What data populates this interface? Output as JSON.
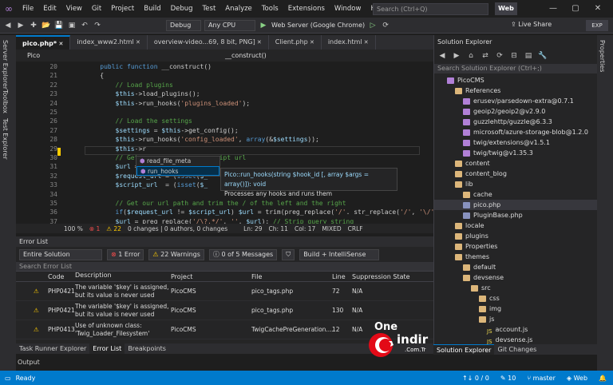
{
  "menubar": {
    "items": [
      "File",
      "Edit",
      "View",
      "Git",
      "Project",
      "Build",
      "Debug",
      "Test",
      "Analyze",
      "Tools",
      "Extensions",
      "Window",
      "Help"
    ],
    "search_placeholder": "Search (Ctrl+Q)",
    "badge": "Web"
  },
  "toolbar": {
    "config": "Debug",
    "platform": "Any CPU",
    "run_target": "Web Server (Google Chrome)",
    "liveshare": "Live Share",
    "exp": "EXP"
  },
  "left_rail": [
    "Server Explorer",
    "Toolbox",
    "Test Explorer"
  ],
  "right_rail": [
    "Properties"
  ],
  "tabs": [
    {
      "label": "pico.php*",
      "active": true
    },
    {
      "label": "index_www2.html",
      "active": false
    },
    {
      "label": "overview-video...69, 8 bit, PNG]",
      "active": false
    },
    {
      "label": "Client.php",
      "active": false
    },
    {
      "label": "index.html",
      "active": false
    }
  ],
  "navbar": {
    "left": "Pico",
    "right": "__construct()"
  },
  "code_lines": [
    {
      "n": "20",
      "t": "    public function __construct()"
    },
    {
      "n": "21",
      "t": "    {"
    },
    {
      "n": "22",
      "t": "        // Load plugins"
    },
    {
      "n": "23",
      "t": "        $this->load_plugins();"
    },
    {
      "n": "24",
      "t": "        $this->run_hooks('plugins_loaded');"
    },
    {
      "n": "25",
      "t": ""
    },
    {
      "n": "26",
      "t": "        // Load the settings"
    },
    {
      "n": "27",
      "t": "        $settings = $this->get_config();"
    },
    {
      "n": "28",
      "t": "        $this->run_hooks('config_loaded', array(&$settings));"
    },
    {
      "n": "29",
      "t": "        $this->r"
    },
    {
      "n": "30",
      "t": "        // Get                  script url"
    },
    {
      "n": "31",
      "t": "        $url ="
    },
    {
      "n": "32",
      "t": "        $request_url = (isset($_"
    },
    {
      "n": "33",
      "t": "        $script_url  = (isset($_"
    },
    {
      "n": "34",
      "t": ""
    },
    {
      "n": "35",
      "t": "        // Get our url path and trim the / of the left and the right"
    },
    {
      "n": "36",
      "t": "        if($request_url != $script_url) $url = trim(preg_replace('/'. str_replace('/', '\\/'"
    },
    {
      "n": "37",
      "t": "        $url = preg_replace('/\\?.*/', '', $url); // Strip query string"
    }
  ],
  "autocomplete": {
    "items": [
      "read_file_meta",
      "run_hooks"
    ],
    "selected": 1
  },
  "tooltip": {
    "signature": "Pico::run_hooks(string $hook_id [, array $args = array()]): void",
    "description": "Processes any hooks and runs them"
  },
  "editor_status": {
    "zoom": "100 %",
    "errors": "1",
    "warnings": "22",
    "changes": "0 changes | 0 authors, 0 changes",
    "ln": "Ln: 29",
    "ch": "Ch: 11",
    "col": "Col: 17",
    "mode": "MIXED",
    "eol": "CRLF"
  },
  "error_list": {
    "title": "Error List",
    "scope": "Entire Solution",
    "errors_btn": "1 Error",
    "warnings_btn": "22 Warnings",
    "messages_btn": "0 of 5 Messages",
    "build_filter": "Build + IntelliSense",
    "search_placeholder": "Search Error List",
    "headers": [
      "Code",
      "Description",
      "Project",
      "File",
      "Line",
      "Suppression State"
    ],
    "rows": [
      {
        "code": "PHP0421",
        "desc": "The variable '$key' is assigned, but its value is never used",
        "project": "PicoCMS",
        "file": "pico_tags.php",
        "line": "72",
        "state": "N/A"
      },
      {
        "code": "PHP0421",
        "desc": "The variable '$key' is assigned, but its value is never used",
        "project": "PicoCMS",
        "file": "pico_tags.php",
        "line": "130",
        "state": "N/A"
      },
      {
        "code": "PHP0413",
        "desc": "Use of unknown class: 'Twig_Loader_Filesystem'",
        "project": "PicoCMS",
        "file": "TwigCachePreGeneration....",
        "line": "12",
        "state": "N/A"
      }
    ]
  },
  "bottom_tabs": [
    "Task Runner Explorer",
    "Error List",
    "Breakpoints"
  ],
  "output_label": "Output",
  "solution_explorer": {
    "title": "Solution Explorer",
    "search_placeholder": "Search Solution Explorer (Ctrl+;)",
    "tree": [
      {
        "label": "PicoCMS",
        "depth": 1,
        "icon": "pkg"
      },
      {
        "label": "References",
        "depth": 2,
        "icon": "folder"
      },
      {
        "label": "erusev/parsedown-extra@0.7.1",
        "depth": 3,
        "icon": "pkg"
      },
      {
        "label": "geoip2/geoip2@v2.9.0",
        "depth": 3,
        "icon": "pkg"
      },
      {
        "label": "guzzlehttp/guzzle@6.3.3",
        "depth": 3,
        "icon": "pkg"
      },
      {
        "label": "microsoft/azure-storage-blob@1.2.0",
        "depth": 3,
        "icon": "pkg"
      },
      {
        "label": "twig/extensions@v1.5.1",
        "depth": 3,
        "icon": "pkg"
      },
      {
        "label": "twig/twig@v1.35.3",
        "depth": 3,
        "icon": "pkg"
      },
      {
        "label": "content",
        "depth": 2,
        "icon": "folder"
      },
      {
        "label": "content_blog",
        "depth": 2,
        "icon": "folder"
      },
      {
        "label": "lib",
        "depth": 2,
        "icon": "folder"
      },
      {
        "label": "cache",
        "depth": 3,
        "icon": "folder"
      },
      {
        "label": "pico.php",
        "depth": 3,
        "icon": "php",
        "selected": true
      },
      {
        "label": "PluginBase.php",
        "depth": 3,
        "icon": "php"
      },
      {
        "label": "locale",
        "depth": 2,
        "icon": "folder"
      },
      {
        "label": "plugins",
        "depth": 2,
        "icon": "folder"
      },
      {
        "label": "Properties",
        "depth": 2,
        "icon": "folder"
      },
      {
        "label": "themes",
        "depth": 2,
        "icon": "folder"
      },
      {
        "label": "default",
        "depth": 3,
        "icon": "folder"
      },
      {
        "label": "devsense",
        "depth": 3,
        "icon": "folder"
      },
      {
        "label": "src",
        "depth": 4,
        "icon": "folder"
      },
      {
        "label": "css",
        "depth": 5,
        "icon": "folder"
      },
      {
        "label": "img",
        "depth": 5,
        "icon": "folder"
      },
      {
        "label": "js",
        "depth": 5,
        "icon": "folder"
      },
      {
        "label": "account.js",
        "depth": 6,
        "icon": "js"
      },
      {
        "label": "devsense.js",
        "depth": 6,
        "icon": "js"
      }
    ],
    "tabs": [
      "Solution Explorer",
      "Git Changes"
    ]
  },
  "statusbar": {
    "ready": "Ready",
    "sync": "0 / 0",
    "pencil": "10",
    "branch": "master",
    "env": "Web"
  },
  "watermark": {
    "line1": "One",
    "line2": "indir",
    "line3": ".Com.Tr"
  },
  "colors": {
    "accent": "#007acc",
    "error": "#e51400",
    "warning": "#ffcc00"
  }
}
